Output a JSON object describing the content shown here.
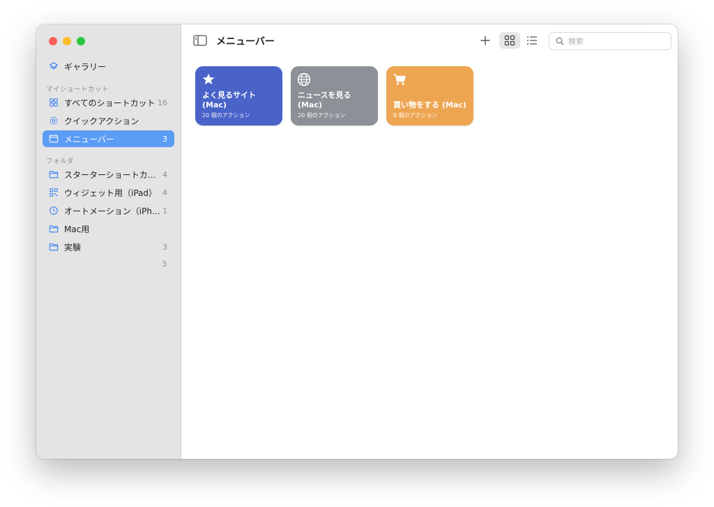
{
  "window": {
    "title": "メニューバー"
  },
  "sidebar": {
    "gallery": {
      "label": "ギャラリー",
      "icon": "layers-icon"
    },
    "sections": [
      {
        "heading": "マイショートカット",
        "items": [
          {
            "label": "すべてのショートカット",
            "count": "16",
            "icon": "grid-icon"
          },
          {
            "label": "クイックアクション",
            "count": "",
            "icon": "gear-icon"
          },
          {
            "label": "メニューバー",
            "count": "3",
            "icon": "menubar-icon",
            "selected": true
          }
        ]
      },
      {
        "heading": "フォルダ",
        "items": [
          {
            "label": "スターターショートカット",
            "count": "4",
            "icon": "folder-icon"
          },
          {
            "label": "ウィジェット用（iPad）",
            "count": "4",
            "icon": "widget-grid-icon"
          },
          {
            "label": "オートメーション（iPho...",
            "count": "1",
            "icon": "automation-clock-icon"
          },
          {
            "label": "Mac用",
            "count": "",
            "icon": "folder-icon"
          },
          {
            "label": "実験",
            "count": "3",
            "icon": "folder-icon"
          }
        ]
      }
    ],
    "orphan_count": "3"
  },
  "toolbar": {
    "title": "メニューバー",
    "search_placeholder": "検索"
  },
  "cards": [
    {
      "name": "よく見るサイト (Mac)",
      "meta": "20 個のアクション",
      "icon": "star-icon",
      "color": "#4a63c9"
    },
    {
      "name": "ニュースを見る (Mac)",
      "meta": "20 個のアクション",
      "icon": "globe-icon",
      "color": "#8c9198"
    },
    {
      "name": "買い物をする (Mac)",
      "meta": "8 個のアクション",
      "icon": "cart-icon",
      "color": "#eea552"
    }
  ],
  "colors": {
    "accent": "#5b9cf5",
    "sidebar_bg": "#e4e4e4"
  }
}
